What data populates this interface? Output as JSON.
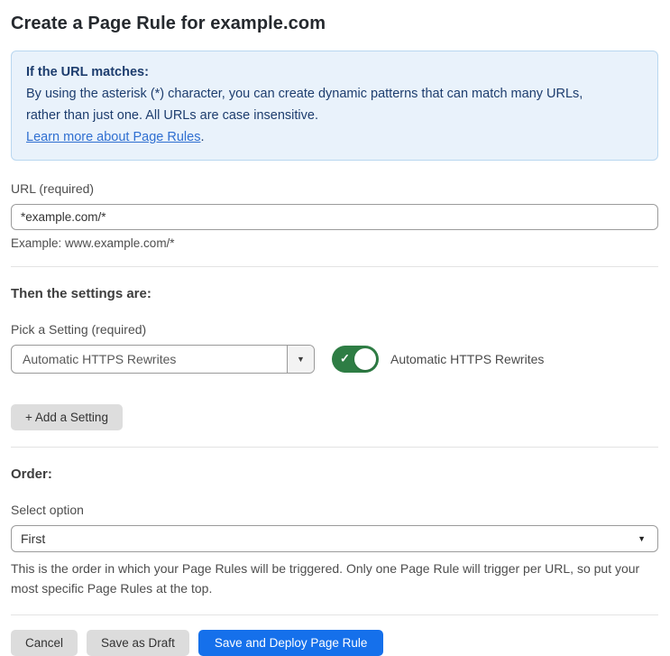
{
  "page": {
    "title": "Create a Page Rule for example.com"
  },
  "callout": {
    "heading": "If the URL matches:",
    "body_line1": "By using the asterisk (*) character, you can create dynamic patterns that can match many URLs,",
    "body_line2": "rather than just one. All URLs are case insensitive.",
    "link_label": "Learn more about Page Rules",
    "link_suffix": "."
  },
  "url_field": {
    "label": "URL (required)",
    "value": "*example.com/*",
    "helper": "Example: www.example.com/*"
  },
  "settings": {
    "heading": "Then the settings are:",
    "pick_label": "Pick a Setting (required)",
    "selected_setting": "Automatic HTTPS Rewrites",
    "dropdown_arrow": "▼",
    "toggle_state": "on",
    "toggle_check": "✓",
    "toggle_label": "Automatic HTTPS Rewrites",
    "add_button_label": "+ Add a Setting"
  },
  "order": {
    "heading": "Order:",
    "label": "Select option",
    "selected_option": "First",
    "arrow": "▼",
    "helper": "This is the order in which your Page Rules will be triggered. Only one Page Rule will trigger per URL, so put your most specific Page Rules at the top."
  },
  "footer": {
    "cancel_label": "Cancel",
    "save_draft_label": "Save as Draft",
    "save_deploy_label": "Save and Deploy Page Rule"
  },
  "colors": {
    "accent_blue": "#1570eb",
    "toggle_green": "#2e7d44",
    "callout_bg": "#e9f2fb",
    "callout_border": "#b9d7f0",
    "callout_text": "#1d3d6e",
    "link_blue": "#2f6fd1",
    "button_gray": "#dcdcdc"
  }
}
